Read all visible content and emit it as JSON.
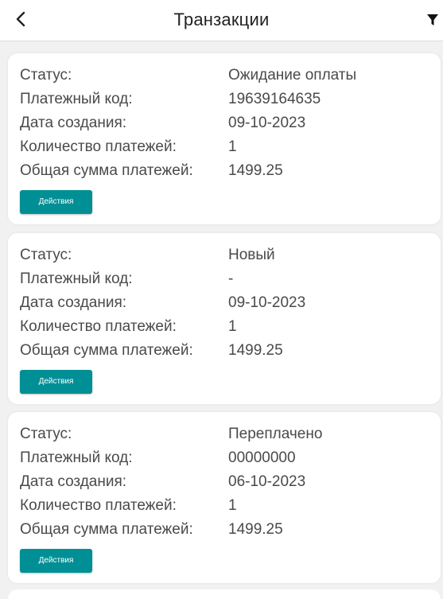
{
  "header": {
    "title": "Транзакции",
    "back_icon": "chevron-left-icon",
    "filter_icon": "filter-icon"
  },
  "transactions": [
    {
      "status_label": "Статус:",
      "status_value": "Ожидание оплаты",
      "code_label": "Платежный код:",
      "code_value": "19639164635",
      "date_label": "Дата создания:",
      "date_value": "09-10-2023",
      "count_label": "Количество платежей:",
      "count_value": "1",
      "sum_label": "Общая сумма платежей:",
      "sum_value": "1499.25",
      "action_label": "Действия"
    },
    {
      "status_label": "Статус:",
      "status_value": "Новый",
      "code_label": "Платежный код:",
      "code_value": "-",
      "date_label": "Дата создания:",
      "date_value": "09-10-2023",
      "count_label": "Количество платежей:",
      "count_value": "1",
      "sum_label": "Общая сумма платежей:",
      "sum_value": "1499.25",
      "action_label": "Действия"
    },
    {
      "status_label": "Статус:",
      "status_value": "Переплачено",
      "code_label": "Платежный код:",
      "code_value": "00000000",
      "date_label": "Дата создания:",
      "date_value": "06-10-2023",
      "count_label": "Количество платежей:",
      "count_value": "1",
      "sum_label": "Общая сумма платежей:",
      "sum_value": "1499.25",
      "action_label": "Действия"
    }
  ],
  "colors": {
    "accent": "#008f95",
    "background": "#f1f1f1",
    "text": "#4a4a4a"
  }
}
